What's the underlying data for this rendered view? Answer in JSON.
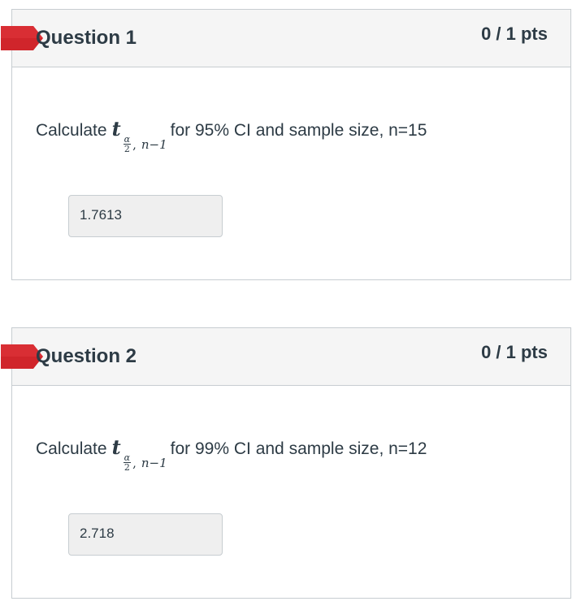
{
  "questions": [
    {
      "title": "Question 1",
      "points": "0 / 1 pts",
      "prompt_before": "Calculate",
      "math_t": "t",
      "math_alpha": "α",
      "math_two": "2",
      "math_comma": ",",
      "math_n1": "n−1",
      "prompt_after": "for 95% CI and sample size, n=15",
      "answer": "1.7613"
    },
    {
      "title": "Question 2",
      "points": "0 / 1 pts",
      "prompt_before": "Calculate",
      "math_t": "t",
      "math_alpha": "α",
      "math_two": "2",
      "math_comma": ",",
      "math_n1": "n−1",
      "prompt_after": "for 99% CI and sample size, n=12",
      "answer": "2.718"
    }
  ],
  "colors": {
    "flag_incorrect": "#d0252b",
    "header_bg": "#f5f5f5",
    "border": "#c7cdd1",
    "text": "#2d3b45"
  },
  "icons": {
    "flag": "incorrect-answer-flag-icon"
  }
}
